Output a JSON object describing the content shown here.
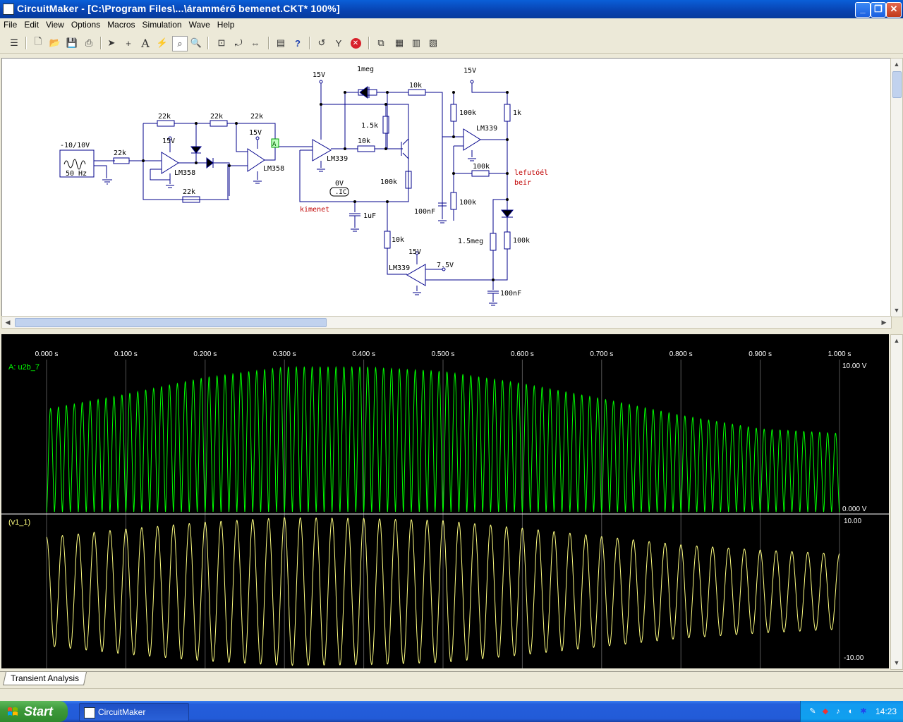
{
  "window": {
    "title": "CircuitMaker - [C:\\Program Files\\...\\árammérő bemenet.CKT* 100%]"
  },
  "menu": [
    "File",
    "Edit",
    "View",
    "Options",
    "Macros",
    "Simulation",
    "Wave",
    "Help"
  ],
  "schematic": {
    "labels": {
      "src_range": "-10/10V",
      "src_freq": "50 Hz",
      "r_in": "22k",
      "r_fb_a": "22k",
      "r_fb_b": "22k",
      "r_fb_c": "22k",
      "r_bottom": "22k",
      "v15_a": "15V",
      "v15_b": "15V",
      "v15_c": "15V",
      "v15_d": "15V",
      "v15_e": "15V",
      "opamp_a": "LM358",
      "opamp_b": "LM358",
      "comp_a": "LM339",
      "comp_b": "LM339",
      "comp_c": "LM339",
      "probe": "A",
      "r_1meg": "1meg",
      "r_10k_a": "10k",
      "r_10k_b": "10k",
      "r_10k_c": "10k",
      "r_1k5": "1.5k",
      "r_100k_a": "100k",
      "r_100k_b": "100k",
      "r_100k_c": "100k",
      "r_100k_d": "100k",
      "r_100k_e": "100k",
      "r_1k": "1k",
      "r_1_5meg": "1.5meg",
      "c_1uf": "1uF",
      "c_100nf_a": "100nF",
      "c_100nf_b": "100nF",
      "ic_volt": "0V",
      "ic_tag": ".IC",
      "net_kimenet": "kimenet",
      "net_lefut_1": "lefutóél",
      "net_lefut_2": "beír",
      "v_ref": "7.5V"
    }
  },
  "wave": {
    "time_ticks": [
      "0.000 s",
      "0.100 s",
      "0.200 s",
      "0.300 s",
      "0.400 s",
      "0.500 s",
      "0.600 s",
      "0.700 s",
      "0.800 s",
      "0.900 s",
      "1.000 s"
    ],
    "trace_a": {
      "name": "A: u2b_7",
      "ymax": "10.00 V",
      "ymin": "0.000 V",
      "color": "#00ff00"
    },
    "trace_b": {
      "name": "(v1_1)",
      "ymax": "10.00",
      "ymin": "-10.00",
      "color": "#ffff80"
    }
  },
  "chart_data": [
    {
      "type": "line",
      "series": [
        {
          "name": "A: u2b_7"
        }
      ],
      "x_range": [
        0,
        1.0
      ],
      "xlabel_ticks": [
        "0.000 s",
        "0.100 s",
        "0.200 s",
        "0.300 s",
        "0.400 s",
        "0.500 s",
        "0.600 s",
        "0.700 s",
        "0.800 s",
        "0.900 s",
        "1.000 s"
      ],
      "ylim": [
        0,
        10
      ],
      "frequency_hz": 100,
      "envelope": {
        "t": [
          0,
          0.1,
          0.2,
          0.3,
          0.4,
          0.5,
          0.6,
          0.7,
          0.8,
          0.9,
          1.0
        ],
        "peak": [
          6.8,
          7.8,
          8.9,
          9.6,
          9.6,
          9.3,
          8.5,
          7.5,
          6.4,
          5.5,
          5.2
        ]
      }
    },
    {
      "type": "line",
      "series": [
        {
          "name": "(v1_1)"
        }
      ],
      "x_range": [
        0,
        1.0
      ],
      "ylim": [
        -10,
        10
      ],
      "frequency_hz": 50,
      "envelope": {
        "t": [
          0,
          0.1,
          0.2,
          0.3,
          0.4,
          0.5,
          0.6,
          0.7,
          0.8,
          0.9,
          1.0
        ],
        "amplitude": [
          7.2,
          8.3,
          9.2,
          9.8,
          9.7,
          9.4,
          8.4,
          7.3,
          6.2,
          5.5,
          5.0
        ]
      }
    }
  ],
  "tabs": {
    "transient": "Transient Analysis"
  },
  "taskbar": {
    "start": "Start",
    "task": "CircuitMaker",
    "clock": "14:23"
  }
}
